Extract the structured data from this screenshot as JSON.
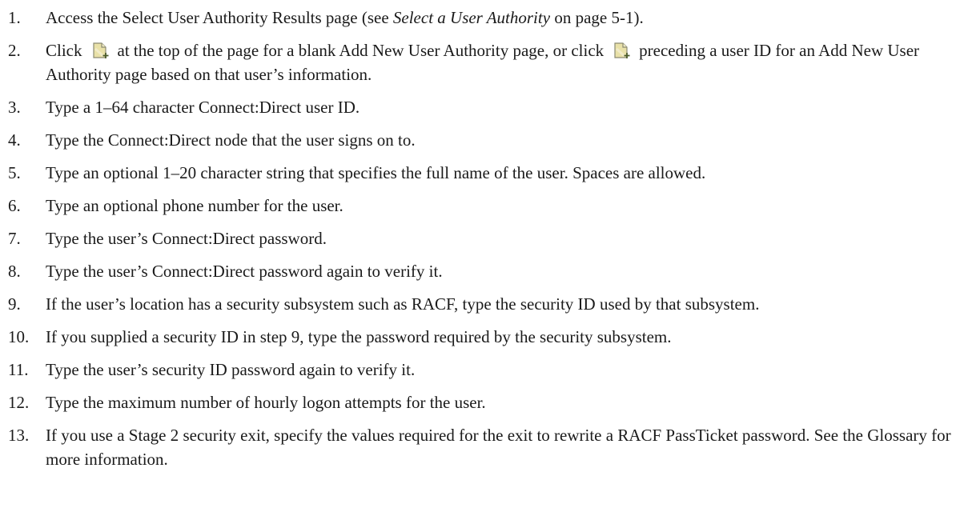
{
  "steps": [
    {
      "num": "1.",
      "a": "Access the Select User Authority Results page (see ",
      "b": "Select a User Authority",
      "c": " on page 5-1)."
    },
    {
      "num": "2.",
      "a": "Click",
      "b": "at the top of the page for a blank Add New User Authority page, or click",
      "c": "preceding a user ID for an Add New User Authority page based on that user’s information.",
      "icon": "new-document-icon"
    },
    {
      "num": "3.",
      "text": "Type a 1–64 character Connect:Direct user ID."
    },
    {
      "num": "4.",
      "text": "Type the Connect:Direct node that the user signs on to."
    },
    {
      "num": "5.",
      "text": "Type an optional 1–20 character string that specifies the full name of the user. Spaces are allowed."
    },
    {
      "num": "6.",
      "text": "Type an optional phone number for the user."
    },
    {
      "num": "7.",
      "text": "Type the user’s Connect:Direct password."
    },
    {
      "num": "8.",
      "text": "Type the user’s Connect:Direct password again to verify it."
    },
    {
      "num": "9.",
      "text": "If the user’s location has a security subsystem such as RACF, type the security ID used by that subsystem."
    },
    {
      "num": "10.",
      "text": "If you supplied a security ID in step 9, type the password required by the security subsystem."
    },
    {
      "num": "11.",
      "text": "Type the user’s security ID password again to verify it."
    },
    {
      "num": "12.",
      "text": "Type the maximum number of hourly logon attempts for the user."
    },
    {
      "num": "13.",
      "text": "If you use a Stage 2 security exit, specify the values required for the exit to rewrite a RACF PassTicket password. See the Glossary for more information."
    }
  ]
}
